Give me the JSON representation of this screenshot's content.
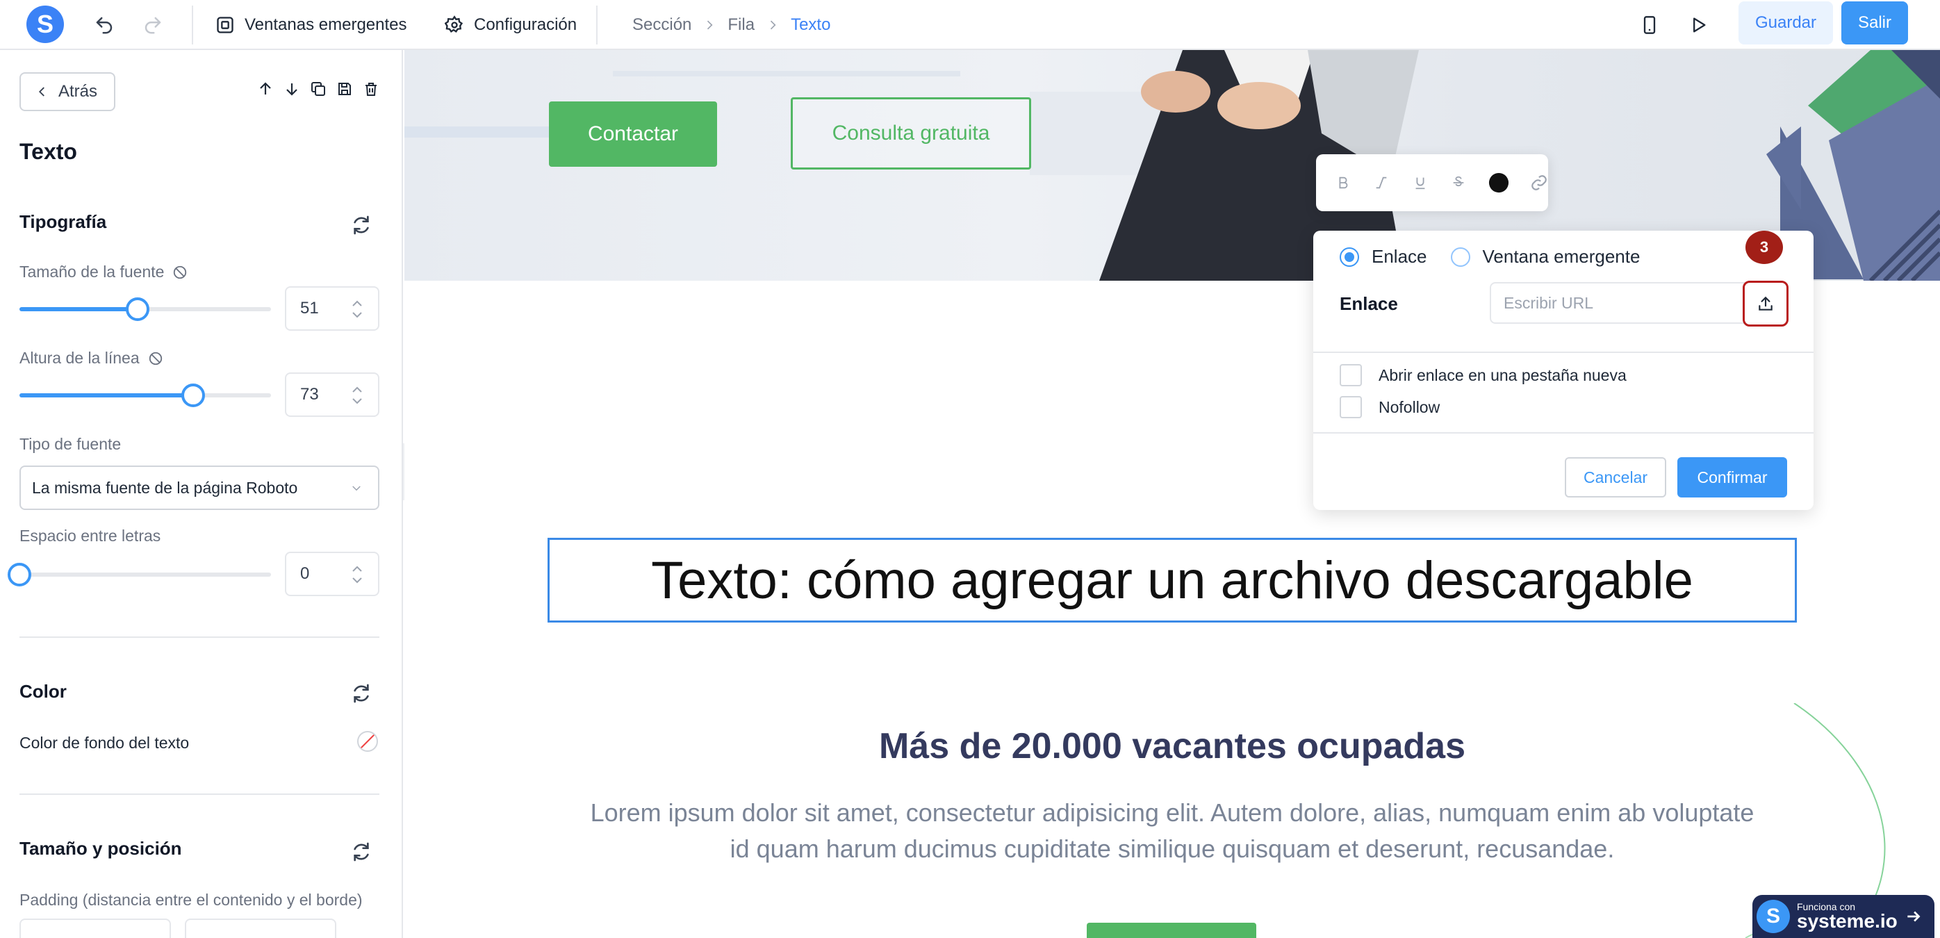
{
  "app": {
    "logo_letter": "S"
  },
  "topbar": {
    "popups_label": "Ventanas emergentes",
    "settings_label": "Configuración",
    "breadcrumb": [
      "Sección",
      "Fila",
      "Texto"
    ],
    "save_label": "Guardar",
    "exit_label": "Salir"
  },
  "panel": {
    "back_label": "Atrás",
    "title": "Texto",
    "typography": {
      "title": "Tipografía",
      "font_size_label": "Tamaño de la fuente",
      "font_size_value": "51",
      "font_size_fraction": 0.47,
      "line_height_label": "Altura de la línea",
      "line_height_value": "73",
      "line_height_fraction": 0.69,
      "font_type_label": "Tipo de fuente",
      "font_type_value": "La misma fuente de la página Roboto",
      "letter_spacing_label": "Espacio entre letras",
      "letter_spacing_value": "0",
      "letter_spacing_fraction": 0.0
    },
    "color": {
      "title": "Color",
      "bg_label": "Color de fondo del texto"
    },
    "size_position": {
      "title": "Tamaño y posición",
      "padding_label": "Padding (distancia entre el contenido y el borde)"
    }
  },
  "canvas": {
    "hero_button_primary": "Contactar",
    "hero_button_secondary": "Consulta gratuita",
    "selected_text": "Texto: cómo agregar un archivo descargable",
    "heading": "Más de 20.000 vacantes ocupadas",
    "paragraph": "Lorem ipsum dolor sit amet, consectetur adipisicing elit. Autem dolore, alias, numquam enim ab voluptate id quam harum ducimus cupiditate similique quisquam et deserunt, recusandae."
  },
  "link_popup": {
    "option_link": "Enlace",
    "option_popup": "Ventana emergente",
    "link_label": "Enlace",
    "url_placeholder": "Escribir URL",
    "step_badge": "3",
    "new_tab_label": "Abrir enlace en una pestaña nueva",
    "nofollow_label": "Nofollow",
    "cancel_label": "Cancelar",
    "confirm_label": "Confirmar"
  },
  "footer_badge": {
    "small_text": "Funciona con",
    "brand": "systeme.io"
  },
  "colors": {
    "accent": "#3b97f6",
    "green": "#52b764",
    "step_badge": "#a21f17"
  }
}
